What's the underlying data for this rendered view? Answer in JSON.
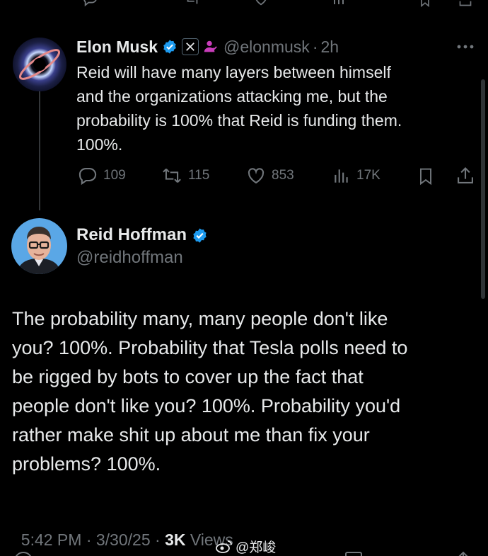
{
  "colors": {
    "background": "#000000",
    "text": "#e7e9ea",
    "muted": "#71767b",
    "verified": "#1d9bf0",
    "divider": "#333639"
  },
  "reply_tweet": {
    "author_name": "Elon Musk",
    "handle": "@elonmusk",
    "separator": "·",
    "time": "2h",
    "text_lines": [
      "Reid will have many layers between himself",
      "and the organizations attacking me, but the",
      "probability is 100% that Reid is funding them.",
      "100%."
    ],
    "actions": {
      "replies": "109",
      "reposts": "115",
      "likes": "853",
      "views": "17K"
    },
    "icons": [
      "verified-badge-icon",
      "x-affiliate-icon",
      "subscriber-icon",
      "more-icon",
      "reply-icon",
      "repost-icon",
      "like-icon",
      "views-icon",
      "bookmark-icon",
      "share-icon"
    ]
  },
  "main_tweet": {
    "author_name": "Reid Hoffman",
    "handle": "@reidhoffman",
    "text_lines": [
      "The probability many, many people don't like",
      "you? 100%. Probability that Tesla polls need to",
      "be rigged by bots to cover up the fact that",
      "people don't like you? 100%. Probability you'd",
      "rather make shit up about me than fix your",
      "problems? 100%."
    ],
    "timestamp": "5:42 PM · 3/30/25 · ",
    "views_count": "3K",
    "views_label": " Views"
  },
  "watermark": {
    "text": "@郑峻",
    "icon": "weibo-icon"
  }
}
